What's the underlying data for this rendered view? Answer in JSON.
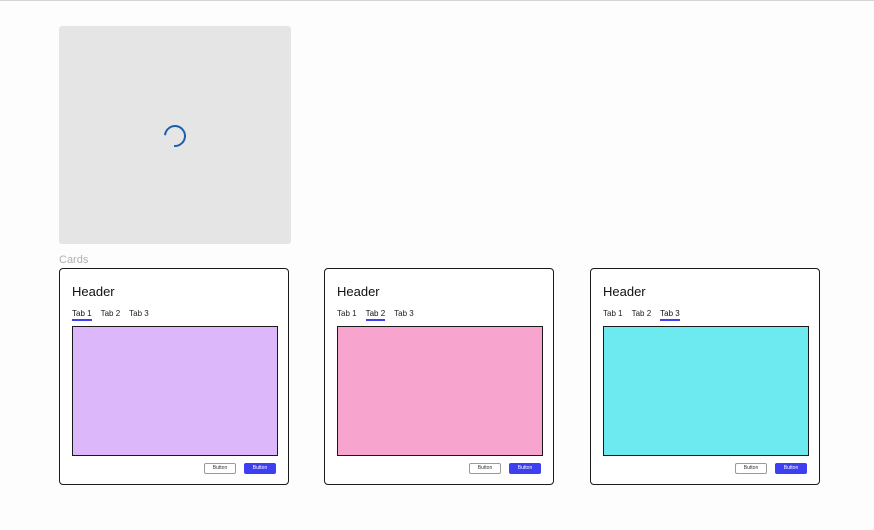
{
  "section": {
    "label": "Cards"
  },
  "loading": {
    "icon": "spinner-icon",
    "color": "#1d5fae"
  },
  "colors": {
    "accent": "#3d3ff0",
    "border": "#1a1a1a",
    "placeholder": "#e5e5e5"
  },
  "cards": [
    {
      "header": "Header",
      "tabs": [
        "Tab 1",
        "Tab 2",
        "Tab 3"
      ],
      "active_tab": 0,
      "panel_color": "#dcb8fb",
      "secondary_button": "Button",
      "primary_button": "Button"
    },
    {
      "header": "Header",
      "tabs": [
        "Tab 1",
        "Tab 2",
        "Tab 3"
      ],
      "active_tab": 1,
      "panel_color": "#f7a4cf",
      "secondary_button": "Button",
      "primary_button": "Button"
    },
    {
      "header": "Header",
      "tabs": [
        "Tab 1",
        "Tab 2",
        "Tab 3"
      ],
      "active_tab": 2,
      "panel_color": "#6deaf0",
      "secondary_button": "Button",
      "primary_button": "Button"
    }
  ]
}
